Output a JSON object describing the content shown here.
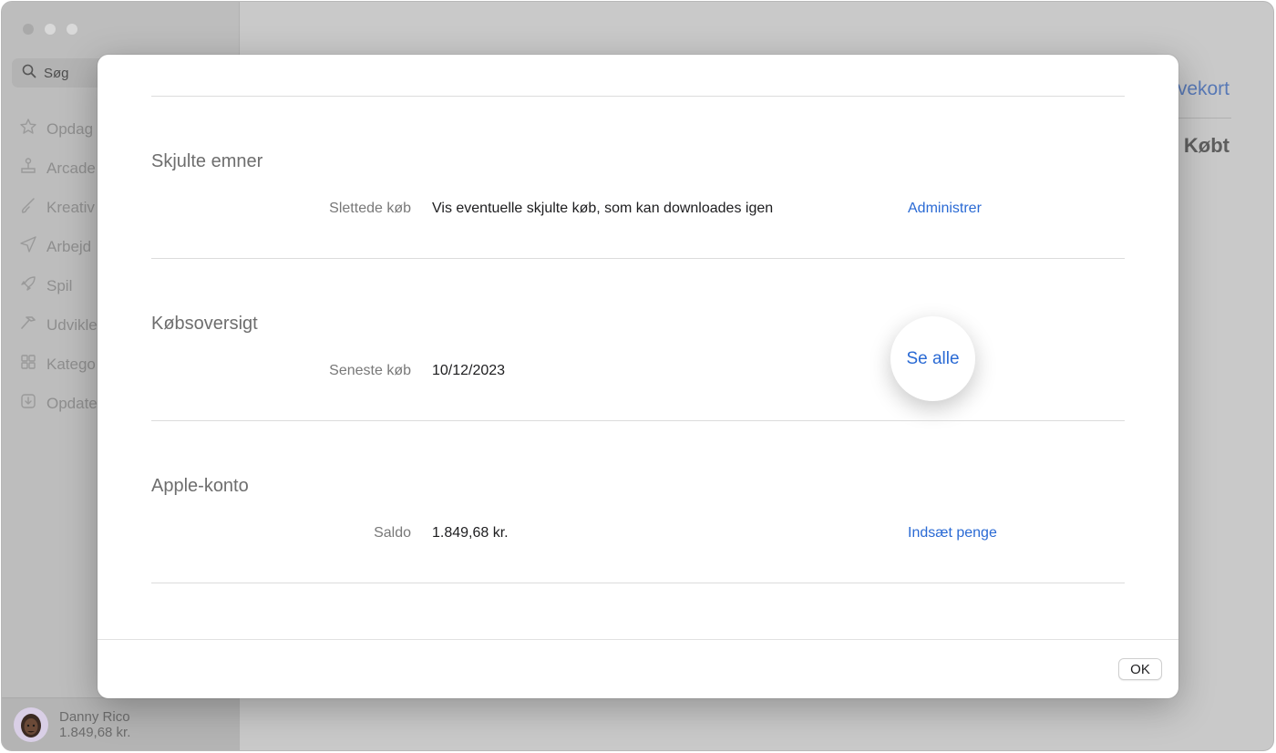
{
  "sidebar": {
    "search_placeholder": "Søg",
    "items": [
      {
        "label": "Opdag",
        "icon": "star-icon"
      },
      {
        "label": "Arcade",
        "icon": "joystick-icon"
      },
      {
        "label": "Kreativ",
        "icon": "brush-icon"
      },
      {
        "label": "Arbejd",
        "icon": "paperplane-icon"
      },
      {
        "label": "Spil",
        "icon": "rocket-icon"
      },
      {
        "label": "Udvikle",
        "icon": "hammer-icon"
      },
      {
        "label": "Katego",
        "icon": "grid-icon"
      },
      {
        "label": "Opdate",
        "icon": "download-icon"
      }
    ],
    "user": {
      "name": "Danny Rico",
      "balance": "1.849,68 kr."
    }
  },
  "main": {
    "link_partial": "vekort",
    "heading_partial": "Købt"
  },
  "sheet": {
    "sections": [
      {
        "title": "Skjulte emner",
        "label": "Slettede køb",
        "value": "Vis eventuelle skjulte køb, som kan downloades igen",
        "action": "Administrer"
      },
      {
        "title": "Købsoversigt",
        "label": "Seneste køb",
        "value": "10/12/2023",
        "action": "Se alle"
      },
      {
        "title": "Apple-konto",
        "label": "Saldo",
        "value": "1.849,68 kr.",
        "action": "Indsæt penge"
      }
    ],
    "ok_label": "OK"
  },
  "colors": {
    "accent": "#2a6ad4",
    "backdrop": "#c9c9c9"
  }
}
